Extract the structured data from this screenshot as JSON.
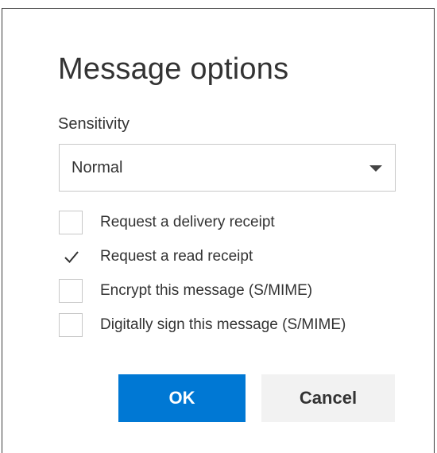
{
  "dialog": {
    "title": "Message options",
    "sensitivity": {
      "label": "Sensitivity",
      "selected": "Normal"
    },
    "options": [
      {
        "label": "Request a delivery receipt",
        "checked": false
      },
      {
        "label": "Request a read receipt",
        "checked": true
      },
      {
        "label": "Encrypt this message (S/MIME)",
        "checked": false
      },
      {
        "label": "Digitally sign this message (S/MIME)",
        "checked": false
      }
    ],
    "buttons": {
      "ok": "OK",
      "cancel": "Cancel"
    }
  },
  "colors": {
    "accent": "#0078d4",
    "secondary_button": "#f2f2f2",
    "text": "#333333",
    "border": "#c8c8c8"
  }
}
